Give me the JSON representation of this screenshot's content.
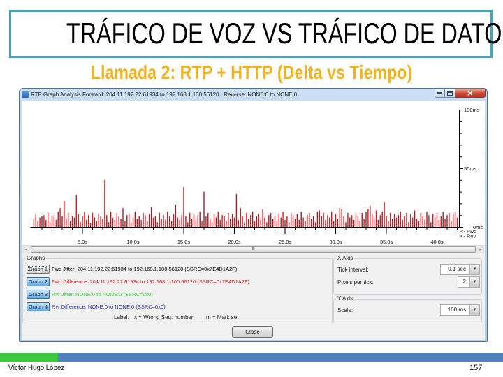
{
  "slide": {
    "title": "TRÁFICO DE VOZ VS TRÁFICO DE DATOS",
    "subtitle": "Llamada 2: RTP + HTTP (Delta vs Tiempo)",
    "footer_author": "Víctor Hugo López",
    "page_number": "157"
  },
  "window": {
    "title": "RTP Graph Analysis Forward: 204.11.192.22:61934 to 192.168.1.100:56120   Reverse: NONE:0 to NONE:0",
    "app_icon": "wireshark-app-icon",
    "controls": [
      "minimize-icon",
      "maximize-icon",
      "close-icon"
    ]
  },
  "scrollbar": {
    "left_arrow": "◂",
    "right_arrow": "▸",
    "grip": "III"
  },
  "graphs": {
    "group_label": "Graphs",
    "items": [
      {
        "button": "Graph 1",
        "label": "Fwd Jitter: 204.11.192.22:61934 to 192.168.1.100:56120 (SSRC=0x7E4D1A2F)",
        "color": "#000000"
      },
      {
        "button": "Graph 2",
        "label": "Fwd Difference: 204.11.192.22:61934 to 192.168.1.100:56120 (SSRC=0x7E4D1A2F)",
        "color": "#d42020"
      },
      {
        "button": "Graph 3",
        "label": "Rvr Jitter: NONE:0 to NONE:0 (SSRC=0x0)",
        "color": "#3ed83e"
      },
      {
        "button": "Graph 4",
        "label": "Rvr Difference: NONE:0 to NONE:0 (SSRC=0x0)",
        "color": "#2a2ab4"
      }
    ],
    "label_caption": "Label:",
    "label_x": "x = Wrong Seq. number",
    "label_m": "m = Mark set"
  },
  "x_axis": {
    "group_label": "X Axis",
    "tick_interval_label": "Tick interval:",
    "tick_interval_value": "0.1 sec",
    "pixels_per_tick_label": "Pixels per tick:",
    "pixels_per_tick_value": "2"
  },
  "y_axis": {
    "group_label": "Y Axis",
    "scale_label": "Scale:",
    "scale_value": "100 ms"
  },
  "close_label": "Close",
  "dropdown_glyph": "▾",
  "colors": {
    "title_border": "#4ba3b6",
    "subtitle": "#f2b320",
    "footer_green": "#3cc83c",
    "footer_blue": "#4f81bd"
  },
  "chart_data": {
    "type": "bar",
    "title": "",
    "xlabel": "",
    "ylabel": "",
    "xlim": [
      0,
      42
    ],
    "ylim": [
      0,
      100
    ],
    "x_ticks": [
      5,
      10,
      15,
      20,
      25,
      30,
      35,
      40
    ],
    "x_tick_labels": [
      "5.0s",
      "10.0s",
      "15.0s",
      "20.0s",
      "25.0s",
      "30.0s",
      "35.0s",
      "40.0s"
    ],
    "x_minor_tick_interval": 1,
    "y_ticks": [
      100,
      50,
      0
    ],
    "y_tick_labels": [
      "100ms",
      "50ms",
      "0ms"
    ],
    "y_minor_tick_interval": 10,
    "y_axis_side": "right",
    "grid": false,
    "legend": [
      "<- Fwd",
      "<- Rev"
    ],
    "legend_position": "bottom-right",
    "series": [
      {
        "name": "Fwd Difference",
        "unit": "ms",
        "x_start": 0.2,
        "x_step": 0.2,
        "colors": [
          "#a51c24",
          "#e0161c"
        ],
        "values": [
          7,
          11,
          5,
          8,
          9,
          10,
          6,
          12,
          4,
          9,
          10,
          6,
          13,
          16,
          9,
          22,
          7,
          12,
          5,
          9,
          8,
          27,
          11,
          4,
          9,
          13,
          6,
          10,
          3,
          12,
          8,
          5,
          11,
          9,
          7,
          40,
          10,
          4,
          13,
          8,
          6,
          12,
          9,
          7,
          16,
          5,
          10,
          11,
          4,
          8,
          13,
          7,
          9,
          6,
          12,
          10,
          5,
          11,
          17,
          8,
          9,
          4,
          12,
          7,
          10,
          6,
          13,
          9,
          5,
          11,
          19,
          8,
          6,
          10,
          34,
          9,
          4,
          12,
          7,
          11,
          6,
          10,
          13,
          5,
          30,
          9,
          12,
          7,
          4,
          11,
          8,
          13,
          6,
          10,
          9,
          5,
          12,
          7,
          11,
          8,
          28,
          6,
          16,
          9,
          4,
          12,
          7,
          10,
          13,
          5,
          9,
          11,
          6,
          15,
          8,
          4,
          10,
          12,
          7,
          9,
          5,
          11,
          8,
          13,
          6,
          9,
          4,
          12,
          10,
          7,
          11,
          6,
          13,
          8,
          5,
          10,
          12,
          7,
          9,
          4,
          13,
          14,
          9,
          12,
          6,
          10,
          8,
          13,
          5,
          11,
          7,
          16,
          15,
          9,
          4,
          12,
          8,
          10,
          6,
          11,
          9,
          5,
          12,
          7,
          13,
          15,
          18,
          11,
          8,
          14,
          6,
          10,
          13,
          21,
          9,
          5,
          12,
          7,
          11,
          8,
          10,
          13,
          6,
          9,
          12,
          4,
          11,
          8,
          14,
          7,
          5,
          12,
          9,
          6,
          13,
          10,
          4,
          11,
          8,
          12,
          6,
          9,
          13,
          7,
          10,
          12,
          5,
          11,
          13,
          8
        ]
      }
    ]
  }
}
